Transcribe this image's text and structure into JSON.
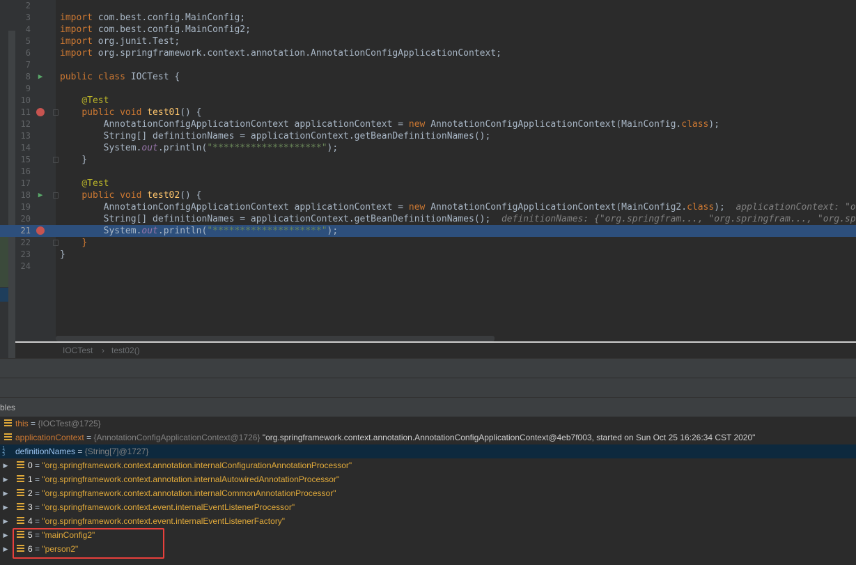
{
  "editor": {
    "lines": [
      {
        "n": "2",
        "html": ""
      },
      {
        "n": "3",
        "html": "<span class='kw'>import</span> com.best.config.MainConfig;"
      },
      {
        "n": "4",
        "html": "<span class='kw'>import</span> com.best.config.MainConfig2;"
      },
      {
        "n": "5",
        "html": "<span class='kw'>import</span> org.junit.Test;"
      },
      {
        "n": "6",
        "html": "<span class='kw'>import</span> org.springframework.context.annotation.AnnotationConfigApplicationContext;"
      },
      {
        "n": "7",
        "html": ""
      },
      {
        "n": "8",
        "html": "<span class='kw'>public class</span> IOCTest {"
      },
      {
        "n": "9",
        "html": ""
      },
      {
        "n": "10",
        "html": "    <span class='ann'>@Test</span>"
      },
      {
        "n": "11",
        "html": "    <span class='kw'>public void</span> <span class='fn'>test01</span>() {"
      },
      {
        "n": "12",
        "html": "        AnnotationConfigApplicationContext applicationContext = <span class='kw'>new</span> AnnotationConfigApplicationContext(MainConfig.<span class='kw'>class</span>);"
      },
      {
        "n": "13",
        "html": "        String[] definitionNames = applicationContext.getBeanDefinitionNames();"
      },
      {
        "n": "14",
        "html": "        System.<span class='st'>out</span>.println(<span class='str'>\"********************\"</span>);"
      },
      {
        "n": "15",
        "html": "    }"
      },
      {
        "n": "16",
        "html": ""
      },
      {
        "n": "17",
        "html": "    <span class='ann'>@Test</span>"
      },
      {
        "n": "18",
        "html": "    <span class='kw'>public void</span> <span class='fn'>test02</span>() {"
      },
      {
        "n": "19",
        "html": "        AnnotationConfigApplicationContext applicationContext = <span class='kw'>new</span> AnnotationConfigApplicationContext(MainConfig2.<span class='kw'>class</span>);  <span class='hint'>applicationContext: \"org.springframework.context.annotation.Annotat</span>"
      },
      {
        "n": "20",
        "html": "        String[] definitionNames = applicationContext.getBeanDefinitionNames();  <span class='hint'>definitionNames: {\"org.springfram..., \"org.springfram..., \"org.springfram...</span>"
      },
      {
        "n": "21",
        "html": "        System.<span class='st'>out</span>.println(<span class='str'>\"********************\"</span>);"
      },
      {
        "n": "22",
        "html": "    <span class='kw'>}</span>"
      },
      {
        "n": "23",
        "html": "}"
      },
      {
        "n": "24",
        "html": ""
      }
    ]
  },
  "breadcrumb": {
    "class_name": "IOCTest",
    "separator": "›",
    "method_name": "test02()"
  },
  "debug": {
    "vars_header": "bles",
    "variables": [
      {
        "name": "this",
        "value": "{IOCTest@1725}"
      },
      {
        "name": "applicationContext",
        "type": "{AnnotationConfigApplicationContext@1726}",
        "value": "\"org.springframework.context.annotation.AnnotationConfigApplicationContext@4eb7f003, started on Sun Oct 25 16:26:34 CST 2020\""
      },
      {
        "name": "definitionNames",
        "value": "{String[7]@1727}"
      }
    ],
    "array_items": [
      {
        "index": "0",
        "value": "\"org.springframework.context.annotation.internalConfigurationAnnotationProcessor\""
      },
      {
        "index": "1",
        "value": "\"org.springframework.context.annotation.internalAutowiredAnnotationProcessor\""
      },
      {
        "index": "2",
        "value": "\"org.springframework.context.annotation.internalCommonAnnotationProcessor\""
      },
      {
        "index": "3",
        "value": "\"org.springframework.context.event.internalEventListenerProcessor\""
      },
      {
        "index": "4",
        "value": "\"org.springframework.context.event.internalEventListenerFactory\""
      },
      {
        "index": "5",
        "value": "\"mainConfig2\""
      },
      {
        "index": "6",
        "value": "\"person2\""
      }
    ],
    "eq": "=",
    "array_glyphs": [
      "1",
      "2",
      "3"
    ],
    "expand_glyph": "▶"
  },
  "colors": {
    "current_line": "#2d4f7c",
    "highlight_box": "#e8403c"
  },
  "icons": {
    "run": "run-test-icon",
    "breakpoint": "breakpoint-icon"
  }
}
